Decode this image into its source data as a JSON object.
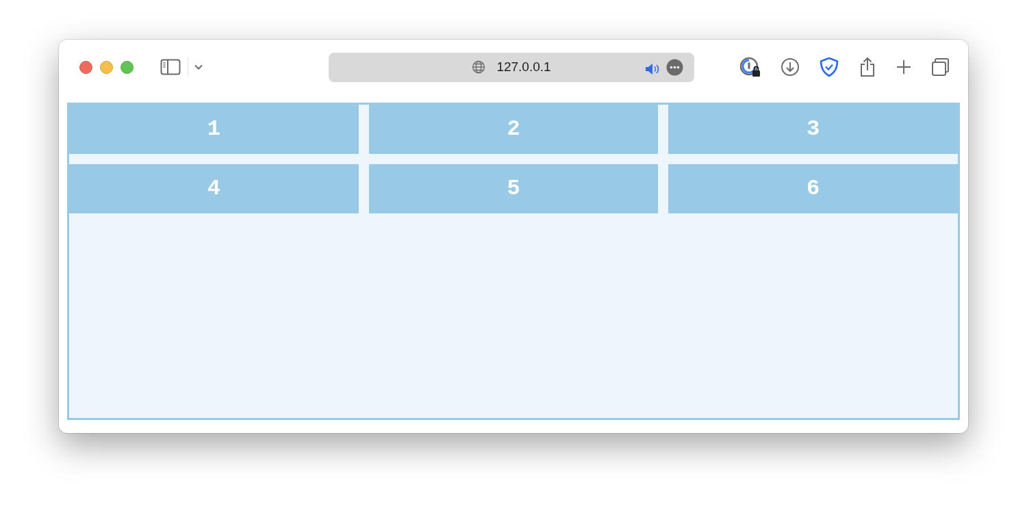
{
  "browser": {
    "address": "127.0.0.1",
    "audio_playing": true
  },
  "grid_items": [
    {
      "label": "1"
    },
    {
      "label": "2"
    },
    {
      "label": "3"
    },
    {
      "label": "4"
    },
    {
      "label": "5"
    },
    {
      "label": "6"
    }
  ]
}
